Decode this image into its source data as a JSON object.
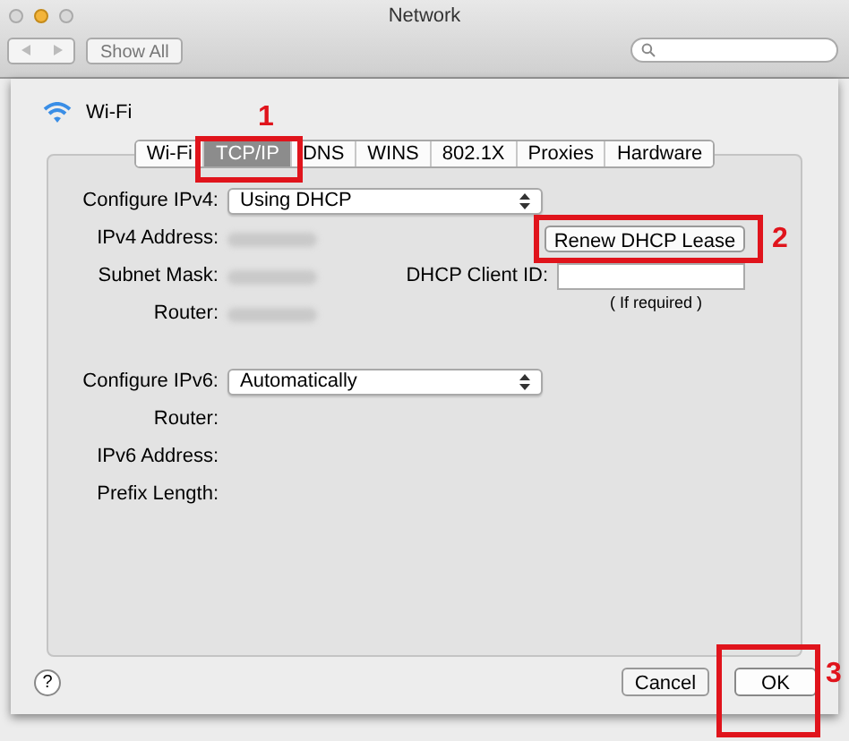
{
  "window": {
    "title": "Network"
  },
  "toolbar": {
    "show_all": "Show All"
  },
  "interface": {
    "name": "Wi-Fi"
  },
  "tabs": [
    {
      "label": "Wi-Fi",
      "selected": false
    },
    {
      "label": "TCP/IP",
      "selected": true
    },
    {
      "label": "DNS",
      "selected": false
    },
    {
      "label": "WINS",
      "selected": false
    },
    {
      "label": "802.1X",
      "selected": false
    },
    {
      "label": "Proxies",
      "selected": false
    },
    {
      "label": "Hardware",
      "selected": false
    }
  ],
  "ipv4_fields": [
    {
      "label": "Configure IPv4:",
      "kind": "popup",
      "value": "Using DHCP"
    },
    {
      "label": "IPv4 Address:",
      "kind": "blurred"
    },
    {
      "label": "Subnet Mask:",
      "kind": "blurred"
    },
    {
      "label": "Router:",
      "kind": "blurred"
    }
  ],
  "renew_button": "Renew DHCP Lease",
  "dhcp_client_id": {
    "label": "DHCP Client ID:",
    "hint": "( If required )"
  },
  "ipv6_fields": [
    {
      "label": "Configure IPv6:",
      "kind": "popup",
      "value": "Automatically"
    },
    {
      "label": "Router:",
      "kind": "empty"
    },
    {
      "label": "IPv6 Address:",
      "kind": "empty"
    },
    {
      "label": "Prefix Length:",
      "kind": "empty"
    }
  ],
  "help": "?",
  "buttons": [
    {
      "label": "Cancel",
      "kind": "normal"
    },
    {
      "label": "OK",
      "kind": "default"
    }
  ],
  "annotations": [
    "1",
    "2",
    "3"
  ]
}
